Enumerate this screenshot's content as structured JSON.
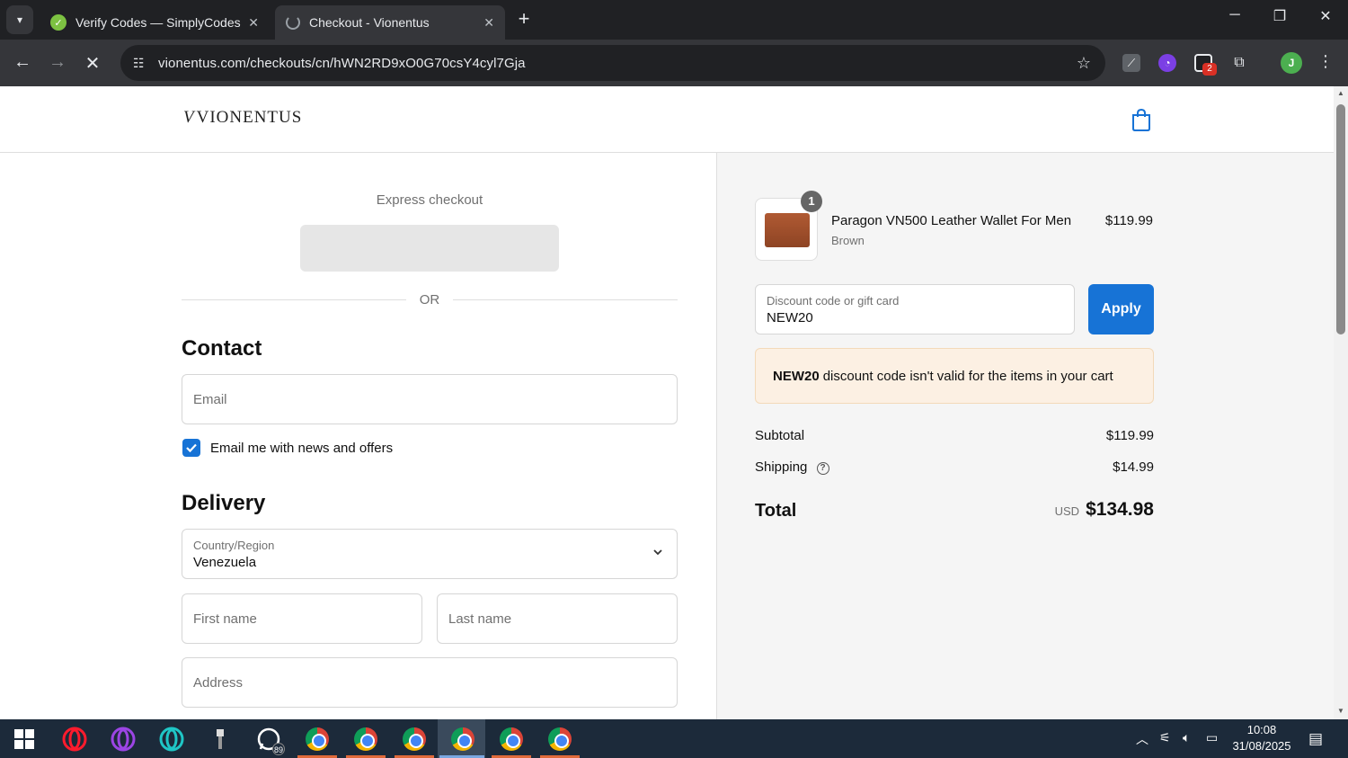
{
  "browser": {
    "tabs": [
      {
        "title": "Verify Codes — SimplyCodes",
        "active": false
      },
      {
        "title": "Checkout - Vionentus",
        "active": true
      }
    ],
    "url": "vionentus.com/checkouts/cn/hWN2RD9xO0G70csY4cyl7Gja",
    "extension_badge": "2",
    "profile_initial": "J"
  },
  "header": {
    "logo_mark": "V",
    "logo_text": "VIONENTUS"
  },
  "checkout": {
    "express_label": "Express checkout",
    "or_label": "OR",
    "contact_heading": "Contact",
    "email_placeholder": "Email",
    "newsletter_label": "Email me with news and offers",
    "newsletter_checked": true,
    "delivery_heading": "Delivery",
    "country_label": "Country/Region",
    "country_value": "Venezuela",
    "first_name_placeholder": "First name",
    "last_name_placeholder": "Last name",
    "address_placeholder": "Address"
  },
  "summary": {
    "item": {
      "quantity": "1",
      "name": "Paragon VN500 Leather Wallet For Men",
      "variant": "Brown",
      "price": "$119.99"
    },
    "discount_label": "Discount code or gift card",
    "discount_value": "NEW20",
    "apply_label": "Apply",
    "error_code": "NEW20",
    "error_text": "discount code isn't valid for the items in your cart",
    "subtotal_label": "Subtotal",
    "subtotal_value": "$119.99",
    "shipping_label": "Shipping",
    "shipping_value": "$14.99",
    "total_label": "Total",
    "total_currency": "USD",
    "total_value": "$134.98"
  },
  "taskbar": {
    "whatsapp_badge": "89",
    "time": "10:08",
    "date": "31/08/2025"
  },
  "colors": {
    "accent": "#1773d6",
    "error_bg": "#fcf0e3",
    "summary_bg": "#f5f5f5",
    "chrome_dark": "#202124"
  }
}
